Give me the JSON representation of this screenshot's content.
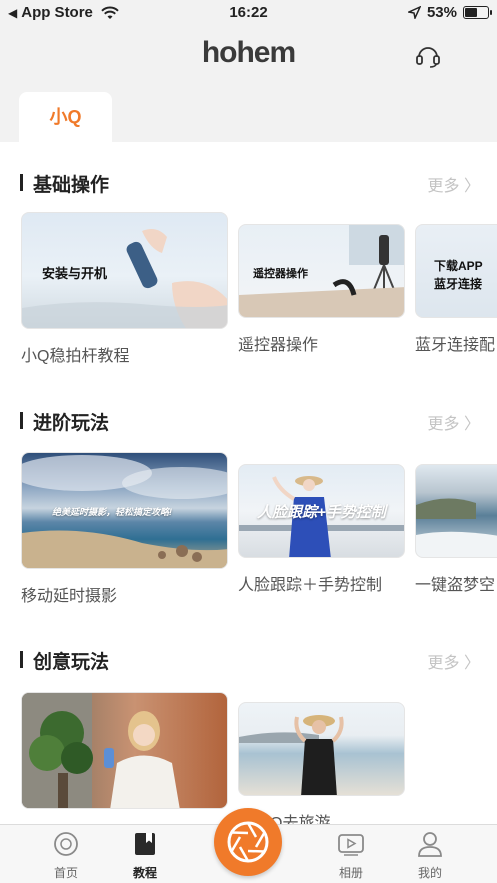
{
  "status_bar": {
    "back_label": "◀",
    "app_store": "App Store",
    "time": "16:22",
    "battery_percent": "53%",
    "battery_level": 0.53
  },
  "header": {
    "logo": "hohem",
    "support_icon": "headset-icon"
  },
  "device_tab": {
    "label": "小Q"
  },
  "sections": [
    {
      "title": "基础操作",
      "more": "更多 〉",
      "cards": [
        {
          "label": "小Q稳拍杆教程",
          "image_text": "安装与开机"
        },
        {
          "label": "遥控器操作",
          "image_text": "遥控器操作"
        },
        {
          "label": "蓝牙连接配",
          "image_text_line1": "下载APP",
          "image_text_line2": "蓝牙连接"
        }
      ]
    },
    {
      "title": "进阶玩法",
      "more": "更多 〉",
      "cards": [
        {
          "label": "移动延时摄影",
          "image_text": "绝美延时摄影，轻松搞定攻略!"
        },
        {
          "label": "人脸跟踪＋手势控制",
          "image_text": "人脸跟踪+手势控制"
        },
        {
          "label": "一键盗梦空"
        }
      ]
    },
    {
      "title": "创意玩法",
      "more": "更多 〉",
      "cards": [
        {
          "label": ""
        },
        {
          "label": "带小Q去旅游"
        }
      ]
    }
  ],
  "bottom_nav": {
    "items": [
      {
        "label": "首页",
        "icon": "home-icon"
      },
      {
        "label": "教程",
        "icon": "tutorial-book-icon"
      },
      {
        "label": "相册",
        "icon": "album-play-icon"
      },
      {
        "label": "我的",
        "icon": "profile-icon"
      }
    ],
    "center_button": "camera-shutter-icon"
  },
  "colors": {
    "accent": "#f07a2a",
    "background": "#f2f2f2"
  }
}
